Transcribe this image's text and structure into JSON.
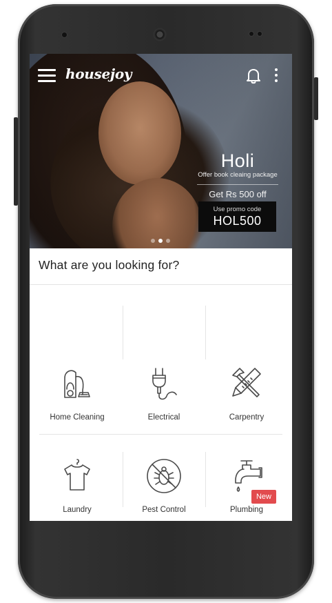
{
  "app": {
    "logo_text": "housejoy"
  },
  "topbar": {
    "menu_icon": "hamburger-menu-icon",
    "notification_icon": "bell-icon",
    "overflow_icon": "kebab-menu-icon"
  },
  "banner": {
    "title": "Holi",
    "subtitle": "Offer book cleaing package",
    "offer": "Get Rs 500 off",
    "promo_label": "Use promo code",
    "promo_code": "HOL500",
    "slides": 3,
    "active_slide": 2
  },
  "section": {
    "title": "What are you looking for?"
  },
  "services": [
    {
      "label": "Home Cleaning",
      "icon": "vacuum-cleaner-icon"
    },
    {
      "label": "Electrical",
      "icon": "electric-plug-icon"
    },
    {
      "label": "Carpentry",
      "icon": "hammer-saw-icon"
    },
    {
      "label": "Laundry",
      "icon": "tshirt-hanger-icon"
    },
    {
      "label": "Pest Control",
      "icon": "no-bug-icon"
    },
    {
      "label": "Plumbing",
      "icon": "water-tap-icon"
    },
    {
      "label": "",
      "icon": "paint-brush-icon"
    },
    {
      "label": "",
      "icon": "steering-wheel-icon"
    },
    {
      "label": "",
      "icon": "door-frame-icon"
    }
  ],
  "badges": {
    "new_label": "New"
  },
  "colors": {
    "badge": "#e24b4e",
    "icon_stroke": "#4a4a4a",
    "promo_box": "#0c0c0c"
  }
}
